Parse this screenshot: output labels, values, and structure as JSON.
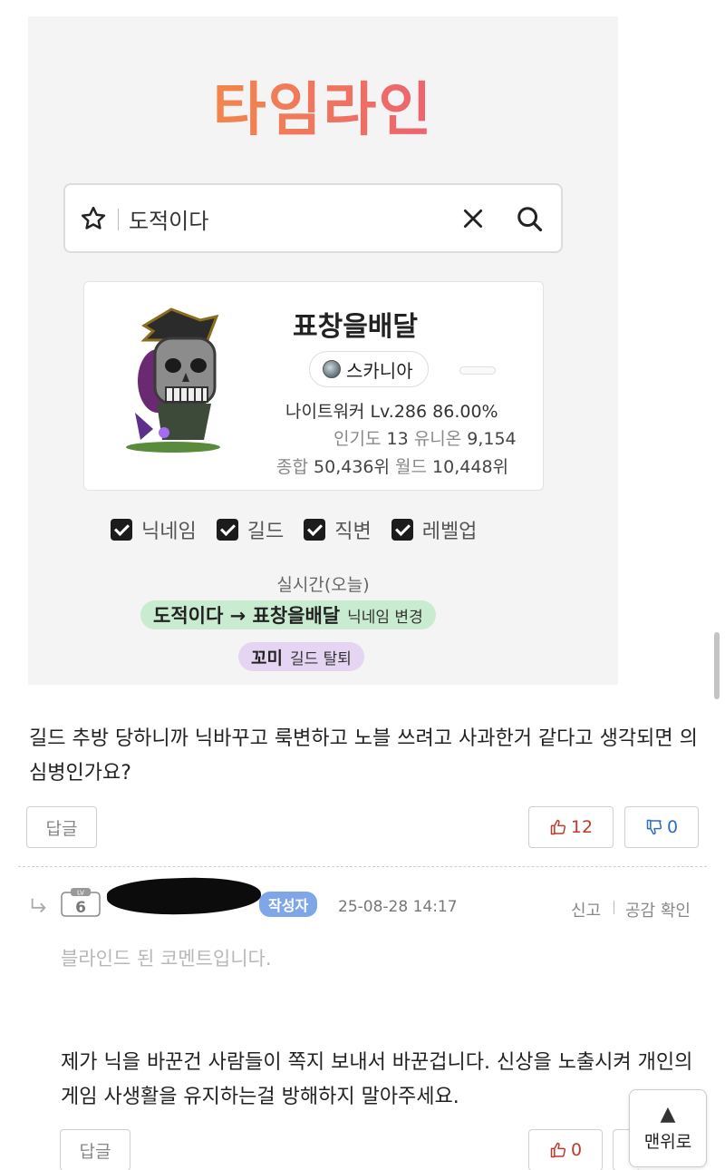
{
  "card": {
    "logo_text": "타임라인",
    "search": {
      "query": "도적이다",
      "star_icon": "star-outline-icon",
      "clear_icon": "close-icon",
      "search_icon": "search-icon"
    },
    "profile": {
      "name": "표창을배달",
      "world": "스카니아",
      "job_level": "나이트워커 Lv.286 86.00%",
      "popularity_label": "인기도",
      "popularity": "13",
      "union_label": "유니온",
      "union": "9,154",
      "overall_label": "종합",
      "overall_rank": "50,436위",
      "world_label": "월드",
      "world_rank": "10,448위"
    },
    "filters": [
      {
        "label": "닉네임",
        "checked": true
      },
      {
        "label": "길드",
        "checked": true
      },
      {
        "label": "직변",
        "checked": true
      },
      {
        "label": "레벨업",
        "checked": true
      }
    ],
    "realtime_label": "실시간(오늘)",
    "changes": [
      {
        "main": "도적이다 → 표창을배달",
        "tag": "닉네임 변경",
        "color": "#c9ebd0"
      },
      {
        "main": "꼬미",
        "tag": "길드 탈퇴",
        "color": "#e5d5f3"
      }
    ]
  },
  "post": {
    "text": "길드 추방 당하니까 닉바꾸고 룩변하고 노블 쓰려고 사과한거 같다고 생각되면 의심병인가요?",
    "reply_label": "답글",
    "upvotes": "12",
    "downvotes": "0"
  },
  "comment": {
    "level": "6",
    "author_badge": "작성자",
    "timestamp": "25-08-28 14:17",
    "report_label": "신고",
    "empathy_label": "공감 확인",
    "blinded_text": "블라인드 된 코멘트입니다.",
    "reply_text": "제가 닉을 바꾼건 사람들이 쪽지 보내서 바꾼겁니다. 신상을 노출시켜 개인의 게임 사생활을 유지하는걸 방해하지 말아주세요.",
    "reply_label": "답글",
    "upvotes": "0"
  },
  "to_top_label": "맨위로",
  "colors": {
    "upvote": "#c0392b",
    "downvote": "#2c6fbf",
    "author_badge": "#7fa7e8"
  }
}
